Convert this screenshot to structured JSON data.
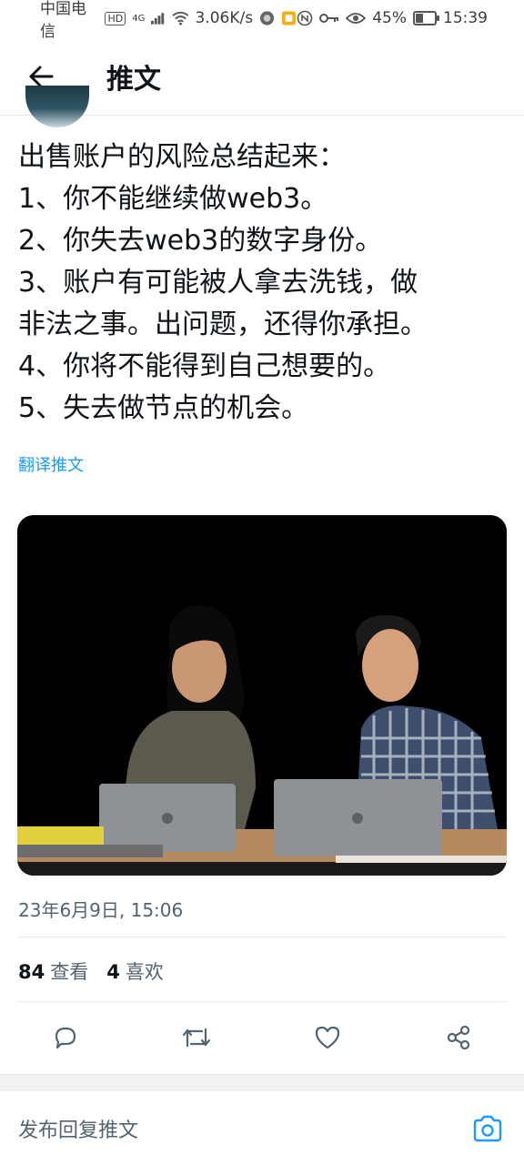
{
  "status_bar": {
    "carrier": "中国电信",
    "hd": "HD",
    "network": "4G",
    "speed": "3.06K/s",
    "battery_percent": "45%",
    "battery_level": 0.45,
    "time": "15:39"
  },
  "header": {
    "title": "推文",
    "back_icon": "arrow-left-icon"
  },
  "tweet": {
    "lines": [
      "出售账户的风险总结起来：",
      "1、你不能继续做web3。",
      "2、你失去web3的数字身份。",
      "3、账户有可能被人拿去洗钱，做",
      "非法之事。出问题，还得你承担。",
      "4、你将不能得到自己想要的。",
      "5、失去做节点的机会。"
    ],
    "translate_label": "翻译推文",
    "timestamp": "23年6月9日, 15:06",
    "views_count": "84",
    "views_label": "查看",
    "likes_count": "4",
    "likes_label": "喜欢"
  },
  "actions": {
    "icons": [
      "reply-icon",
      "retweet-icon",
      "like-icon",
      "share-icon"
    ]
  },
  "reply": {
    "placeholder": "发布回复推文",
    "camera_icon": "camera-icon"
  },
  "colors": {
    "text": "#0f1419",
    "secondary": "#536471",
    "link": "#1d9bf0",
    "divider": "#e6e6e6"
  }
}
